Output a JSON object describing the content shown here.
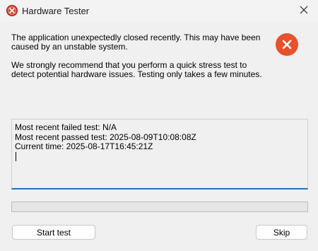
{
  "window": {
    "title": "Hardware Tester",
    "close_icon": "close-icon",
    "app_icon": "error-icon"
  },
  "message": {
    "paragraph1": "The application unexpectedly closed recently. This may have been caused by an unstable system.",
    "paragraph2": "We strongly recommend that you perform a quick stress test to detect potential hardware issues. Testing only takes a few minutes."
  },
  "log": {
    "lines": [
      "Most recent failed test: N/A",
      "Most recent passed test: 2025-08-09T10:08:08Z",
      "Current time: 2025-08-17T16:45:21Z"
    ]
  },
  "progress": {
    "value": 0
  },
  "buttons": {
    "start_label": "Start test",
    "skip_label": "Skip"
  },
  "colors": {
    "error_red": "#e8512a",
    "accent_blue": "#2b6cb0",
    "window_bg": "#f0f0f0"
  }
}
